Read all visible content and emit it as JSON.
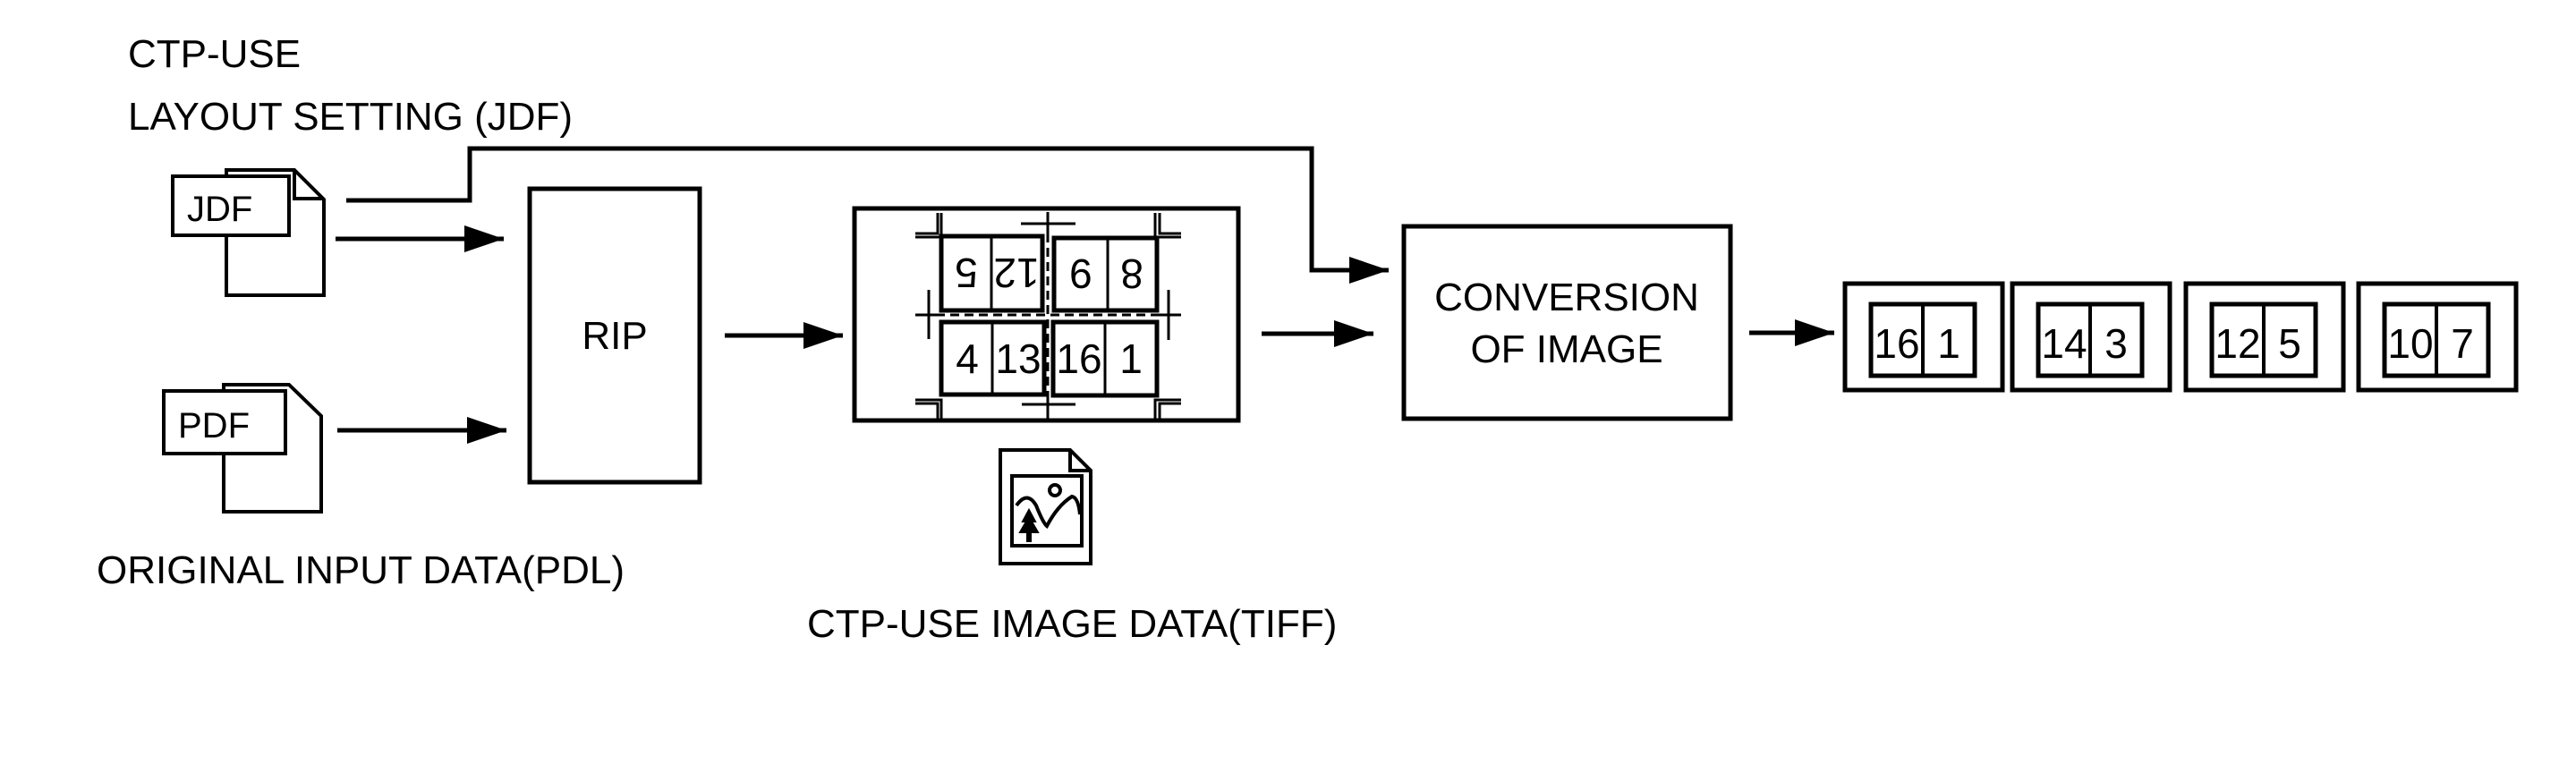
{
  "diagram": {
    "type": "process-flow",
    "colors": {
      "stroke": "#000000",
      "background": "#ffffff"
    }
  },
  "labels": {
    "layout_setting_line1": "CTP-USE",
    "layout_setting_line2": "LAYOUT SETTING (JDF)",
    "original_input": "ORIGINAL INPUT DATA(PDL)",
    "ctp_image_data": "CTP-USE IMAGE DATA(TIFF)"
  },
  "inputs": [
    {
      "id": "jdf",
      "icon": "document-icon",
      "label": "JDF"
    },
    {
      "id": "pdf",
      "icon": "document-icon",
      "label": "PDF"
    }
  ],
  "nodes": {
    "rip": {
      "label": "RIP"
    },
    "conversion": {
      "line1": "CONVERSION",
      "line2": "OF IMAGE"
    }
  },
  "imposition_sheet": {
    "icon": "image-file-icon",
    "blocks": [
      {
        "position": "top-left",
        "pages": [
          "5",
          "12"
        ],
        "rotated": true
      },
      {
        "position": "top-right",
        "pages": [
          "9",
          "8"
        ],
        "rotated": true
      },
      {
        "position": "bottom-left",
        "pages": [
          "4",
          "13"
        ],
        "rotated": false
      },
      {
        "position": "bottom-right",
        "pages": [
          "16",
          "1"
        ],
        "rotated": false
      }
    ]
  },
  "output_sheets": [
    {
      "pages": [
        "16",
        "1"
      ]
    },
    {
      "pages": [
        "14",
        "3"
      ]
    },
    {
      "pages": [
        "12",
        "5"
      ]
    },
    {
      "pages": [
        "10",
        "7"
      ]
    }
  ],
  "edges": [
    {
      "from": "jdf",
      "to": "conversion"
    },
    {
      "from": "jdf",
      "to": "rip"
    },
    {
      "from": "pdf",
      "to": "rip"
    },
    {
      "from": "rip",
      "to": "imposition_sheet"
    },
    {
      "from": "imposition_sheet",
      "to": "conversion"
    },
    {
      "from": "conversion",
      "to": "output_sheets"
    }
  ]
}
